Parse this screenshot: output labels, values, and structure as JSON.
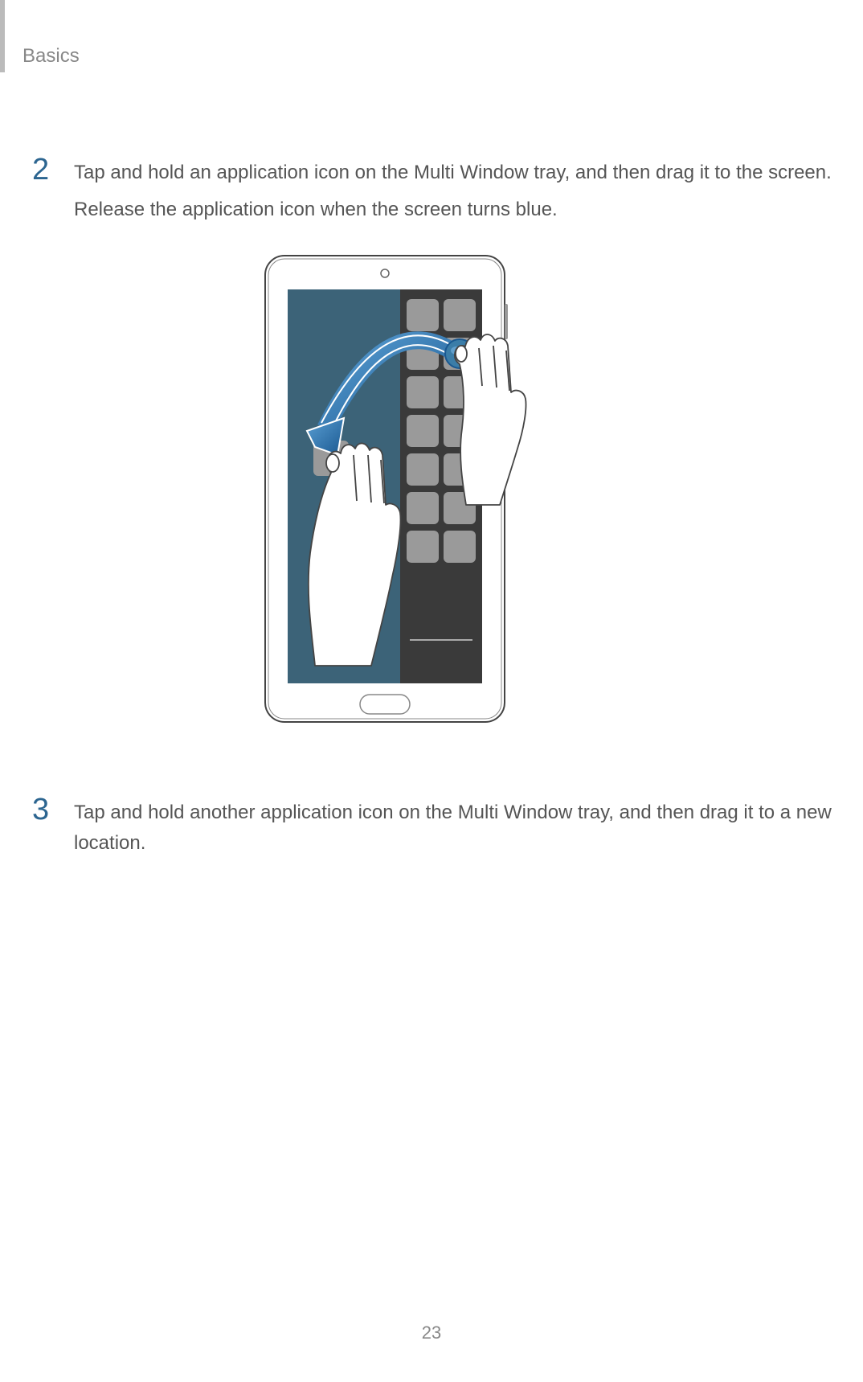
{
  "header": {
    "section_title": "Basics"
  },
  "steps": {
    "step2": {
      "number": "2",
      "line1": "Tap and hold an application icon on the Multi Window tray, and then drag it to the screen.",
      "line2": "Release the application icon when the screen turns blue."
    },
    "step3": {
      "number": "3",
      "text": "Tap and hold another application icon on the Multi Window tray, and then drag it to a new location."
    }
  },
  "footer": {
    "page_number": "23"
  }
}
